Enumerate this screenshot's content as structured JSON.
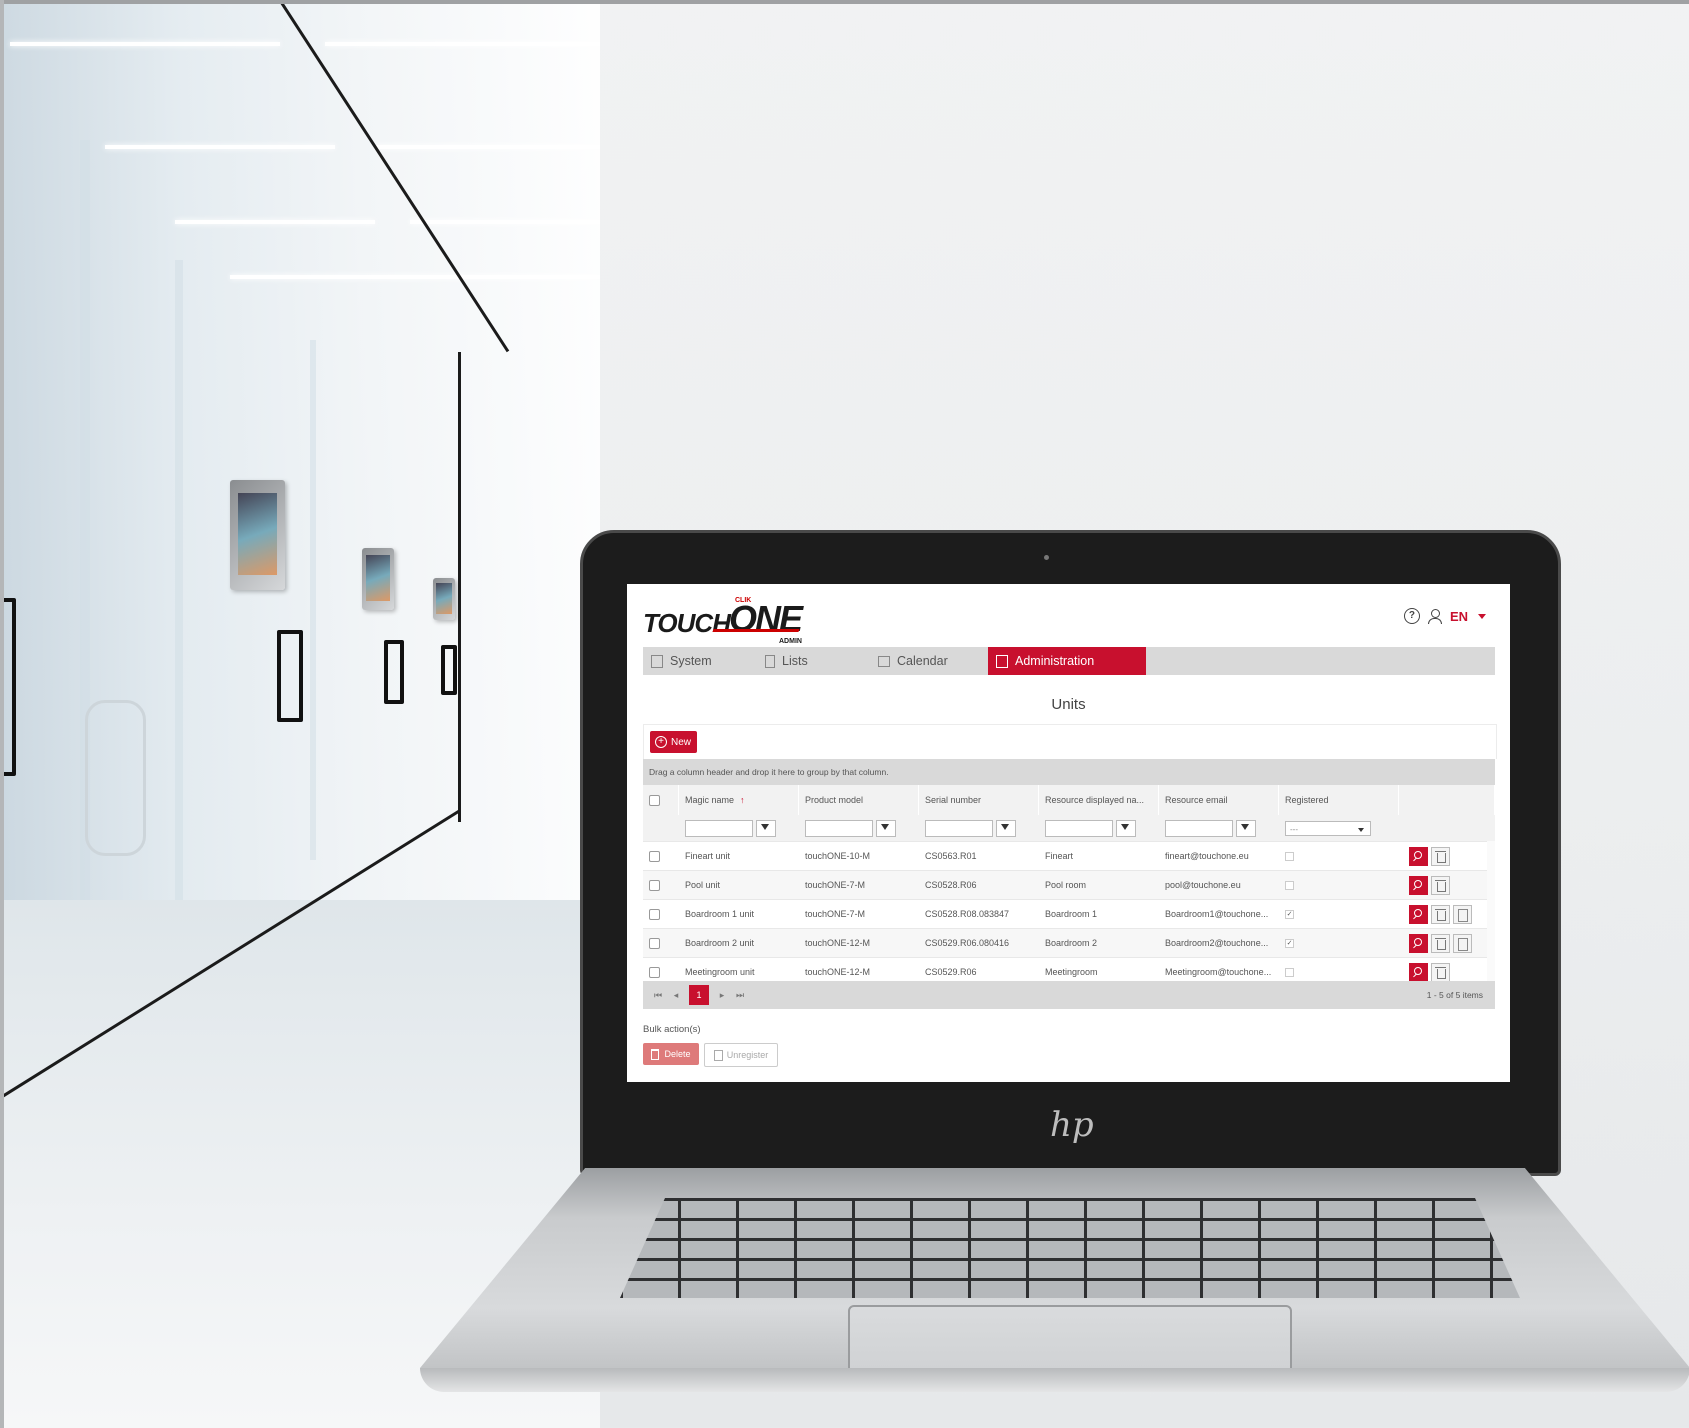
{
  "app": {
    "logo": {
      "word1": "TOUCH",
      "word2": "ONE",
      "tagline_top": "CLIK",
      "tagline_bottom": "ADMIN"
    },
    "header": {
      "language": "EN"
    },
    "tabs": [
      {
        "label": "System",
        "icon": "system-icon",
        "active": false
      },
      {
        "label": "Lists",
        "icon": "list-icon",
        "active": false
      },
      {
        "label": "Calendar",
        "icon": "calendar-icon",
        "active": false
      },
      {
        "label": "Administration",
        "icon": "admin-icon",
        "active": true
      }
    ],
    "page_title": "Units",
    "new_button": "New",
    "group_hint": "Drag a column header and drop it here to group by that column.",
    "columns": [
      "Magic name",
      "Product model",
      "Serial number",
      "Resource displayed na...",
      "Resource email",
      "Registered"
    ],
    "registered_filter": "---",
    "rows": [
      {
        "name": "Fineart unit",
        "model": "touchONE-10-M",
        "serial": "CS0563.R01",
        "resource": "Fineart",
        "email": "fineart@touchone.eu",
        "registered": false
      },
      {
        "name": "Pool unit",
        "model": "touchONE-7-M",
        "serial": "CS0528.R06",
        "resource": "Pool room",
        "email": "pool@touchone.eu",
        "registered": false
      },
      {
        "name": "Boardroom 1 unit",
        "model": "touchONE-7-M",
        "serial": "CS0528.R08.083847",
        "resource": "Boardroom 1",
        "email": "Boardroom1@touchone...",
        "registered": true
      },
      {
        "name": "Boardroom 2 unit",
        "model": "touchONE-12-M",
        "serial": "CS0529.R06.080416",
        "resource": "Boardroom 2",
        "email": "Boardroom2@touchone...",
        "registered": true
      },
      {
        "name": "Meetingroom unit",
        "model": "touchONE-12-M",
        "serial": "CS0529.R06",
        "resource": "Meetingroom",
        "email": "Meetingroom@touchone...",
        "registered": false
      }
    ],
    "pager": {
      "current_page": "1",
      "info": "1 - 5 of 5 items"
    },
    "bulk": {
      "label": "Bulk action(s)",
      "delete": "Delete",
      "unregister": "Unregister"
    }
  },
  "colors": {
    "accent": "#c8102e",
    "toolbar_gray": "#d9d9d9"
  }
}
